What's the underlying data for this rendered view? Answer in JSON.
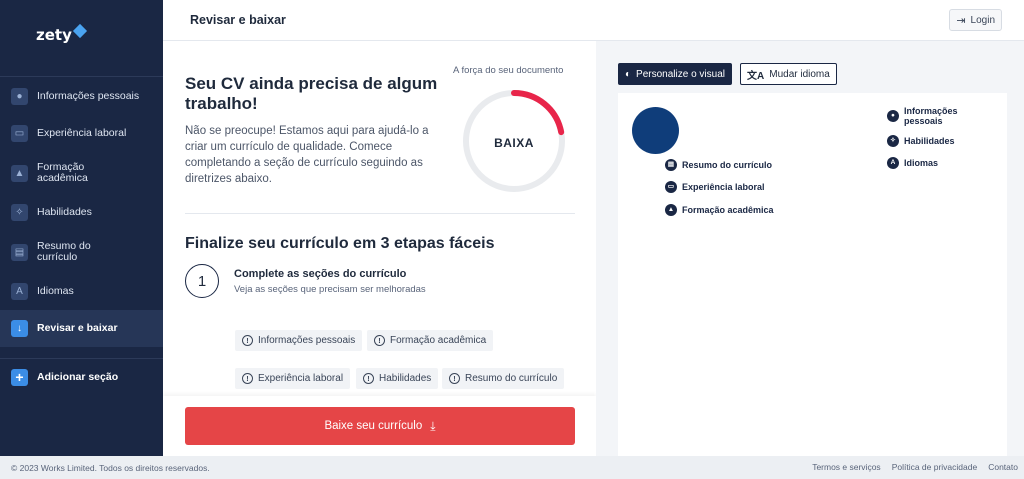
{
  "brand": {
    "logo_text": "zety",
    "accent": "#3b8de6",
    "sidebar_bg": "#1a2744"
  },
  "sidebar": {
    "items": [
      {
        "label": "Informações pessoais",
        "icon": "person-icon"
      },
      {
        "label": "Experiência laboral",
        "icon": "briefcase-icon"
      },
      {
        "label": "Formação acadêmica",
        "icon": "graduation-cap-icon"
      },
      {
        "label": "Habilidades",
        "icon": "lightbulb-icon"
      },
      {
        "label": "Resumo do currículo",
        "icon": "chat-icon"
      },
      {
        "label": "Idiomas",
        "icon": "translate-icon"
      },
      {
        "label": "Revisar e baixar",
        "icon": "download-icon",
        "active": true
      }
    ],
    "add_section_label": "Adicionar seção"
  },
  "header": {
    "title": "Revisar e baixar",
    "login_label": "Login"
  },
  "main": {
    "cv_title": "Seu CV ainda precisa de algum trabalho!",
    "cv_description": "Não se preocupe! Estamos aqui para ajudá-lo a criar um currículo de qualidade. Comece completando a seção de currículo seguindo as diretrizes abaixo.",
    "strength_label": "A força do seu documento",
    "strength_value": "BAIXA",
    "strength_fraction": 0.22,
    "strength_color": "#e8254a",
    "steps_title": "Finalize seu currículo em 3 etapas fáceis",
    "step_number": "1",
    "step_title": "Complete as seções do currículo",
    "step_subtitle": "Veja as seções que precisam ser melhoradas",
    "tags": [
      "Informações pessoais",
      "Formação acadêmica",
      "Experiência laboral",
      "Habilidades",
      "Resumo do currículo"
    ],
    "download_label": "Baixe seu currículo",
    "download_color": "#e54547"
  },
  "preview": {
    "personalize_label": "Personalize o visual",
    "language_label": "Mudar idioma",
    "left_sections": [
      "Resumo do currículo",
      "Experiência laboral",
      "Formação acadêmica"
    ],
    "right_sections": [
      "Informações pessoais",
      "Habilidades",
      "Idiomas"
    ]
  },
  "footer": {
    "copyright": "© 2023 Works Limited. Todos os direitos reservados.",
    "links": [
      "Termos e serviços",
      "Política de privacidade",
      "Contato"
    ]
  }
}
